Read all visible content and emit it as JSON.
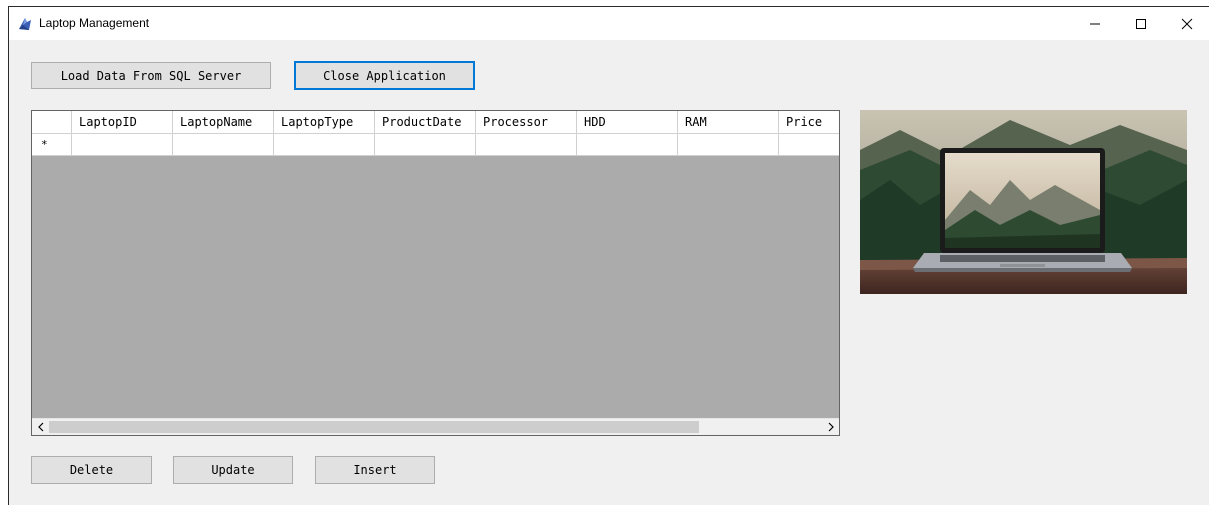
{
  "window": {
    "title": "Laptop Management"
  },
  "toolbar": {
    "load_label": "Load Data From SQL Server",
    "close_label": "Close Application"
  },
  "grid": {
    "columns": [
      "LaptopID",
      "LaptopName",
      "LaptopType",
      "ProductDate",
      "Processor",
      "HDD",
      "RAM",
      "Price"
    ],
    "new_row_marker": "*"
  },
  "actions": {
    "delete_label": "Delete",
    "update_label": "Update",
    "insert_label": "Insert"
  },
  "scrollbar": {
    "left_arrow": "<",
    "right_arrow": ">"
  },
  "colors": {
    "grid_background": "#ababab",
    "window_background": "#f0f0f0",
    "focus_border": "#0078d7"
  }
}
